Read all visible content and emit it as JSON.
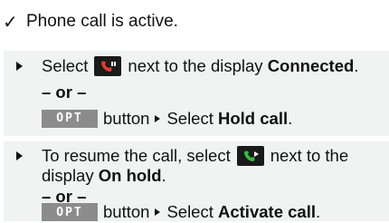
{
  "prerequisite": {
    "check_glyph": "✓",
    "text": "Phone call is active."
  },
  "steps": [
    {
      "line1_a": "Select",
      "line1_b": "next to the display",
      "line1_bold": "Connected",
      "line1_end": ".",
      "or": "– or –",
      "opt_label": "OPT",
      "line3_a": "button",
      "line3_b": "Select",
      "line3_bold": "Hold call",
      "line3_end": "."
    },
    {
      "line1_a": "To resume the call, select",
      "line1_b": "next to the",
      "line2_a": "display",
      "line2_bold": "On hold",
      "line2_end": ".",
      "or": "– or –",
      "opt_label": "OPT",
      "line4_a": "button",
      "line4_b": "Select",
      "line4_bold": "Activate call",
      "line4_end": "."
    }
  ],
  "icons": {
    "hangup": "phone-hang-up-icon",
    "resume": "phone-resume-icon",
    "bullet": "triangle-bullet"
  },
  "colors": {
    "panel_bg": "#f1f2f2",
    "opt_bg": "#8c8c8c",
    "icon_bg": "#1a1a1a",
    "handset_red": "#e23a2c",
    "handset_green": "#2fbf3b"
  }
}
